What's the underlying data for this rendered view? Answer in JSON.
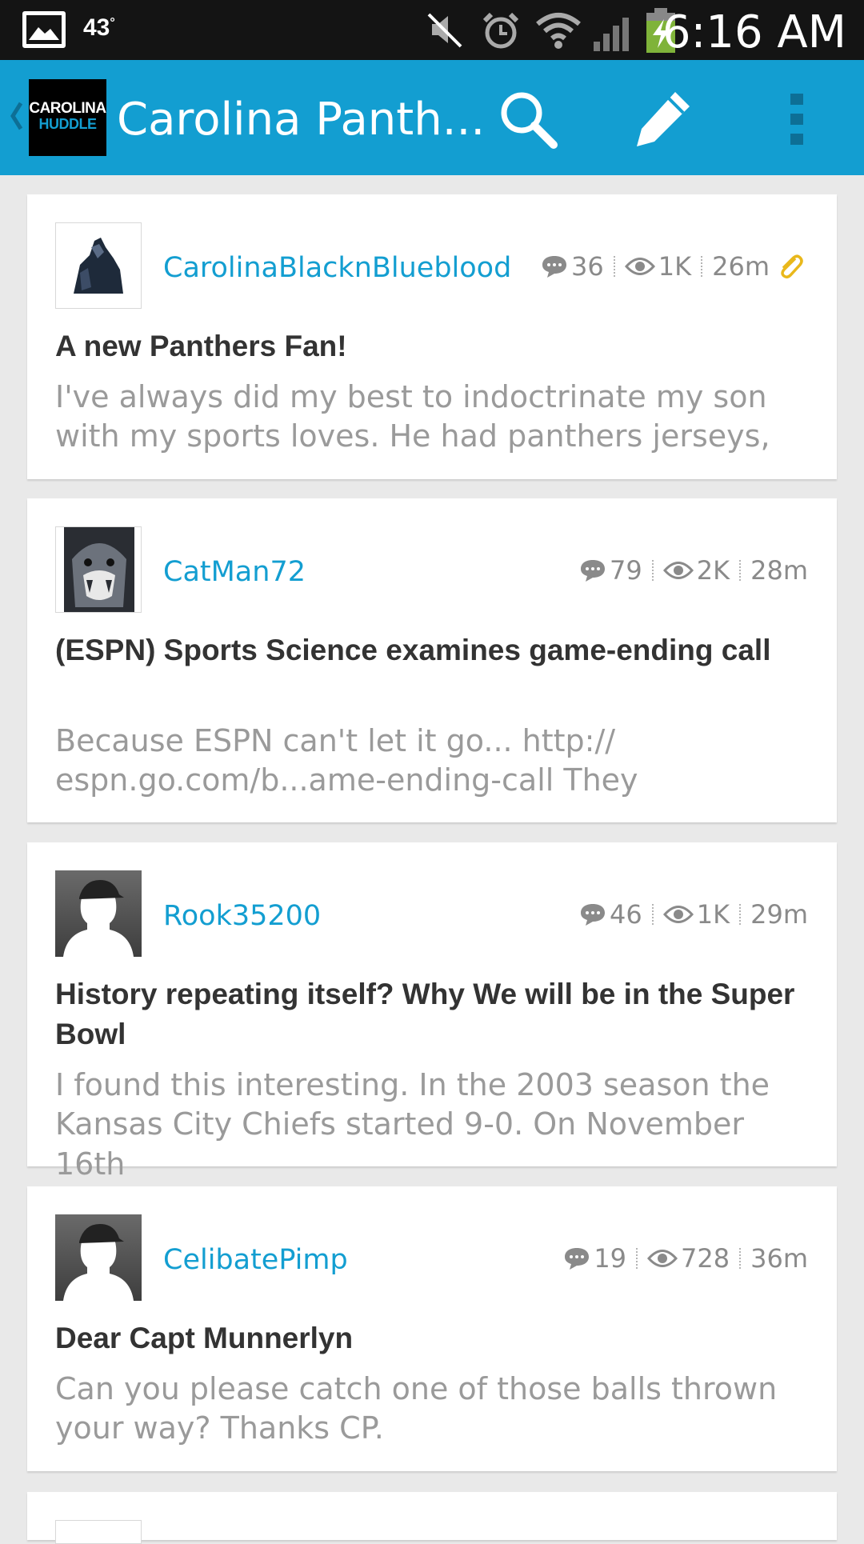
{
  "status_bar": {
    "temperature": "43",
    "degree": "°",
    "time": "6:16 AM",
    "icons": [
      "gallery-icon",
      "mute-icon",
      "alarm-icon",
      "wifi-icon",
      "signal-icon",
      "battery-charging-icon"
    ]
  },
  "action_bar": {
    "logo_line1": "CAROLINA",
    "logo_line2": "HUDDLE",
    "title": "Carolina Panth...",
    "actions": [
      "search-icon",
      "compose-icon",
      "overflow-menu-icon"
    ],
    "accent_color": "#139ed1"
  },
  "posts": [
    {
      "username": "CarolinaBlacknBlueblood",
      "replies": "36",
      "views": "1K",
      "age": "26m",
      "has_attachment": true,
      "title": "A new Panthers Fan!",
      "excerpt_line1": "I've always did my best to indoctrinate my son",
      "excerpt_line2": "with my sports loves. He had panthers jerseys,"
    },
    {
      "username": "CatMan72",
      "replies": "79",
      "views": "2K",
      "age": "28m",
      "has_attachment": false,
      "title": "(ESPN) Sports Science examines game-ending call",
      "excerpt_line1": "Because ESPN can't let it go... http://",
      "excerpt_line2": "espn.go.com/b...ame-ending-call They"
    },
    {
      "username": "Rook35200",
      "replies": "46",
      "views": "1K",
      "age": "29m",
      "has_attachment": false,
      "title": "History repeating itself? Why We will be in the Super Bowl",
      "excerpt_line1": "I found this interesting. In the 2003 season the",
      "excerpt_line2": "Kansas City Chiefs started 9-0. On November 16th"
    },
    {
      "username": "CelibatePimp",
      "replies": "19",
      "views": "728",
      "age": "36m",
      "has_attachment": false,
      "title": "Dear Capt Munnerlyn",
      "excerpt_line1": "Can you please catch one of those balls thrown",
      "excerpt_line2": "your way? Thanks CP."
    }
  ]
}
